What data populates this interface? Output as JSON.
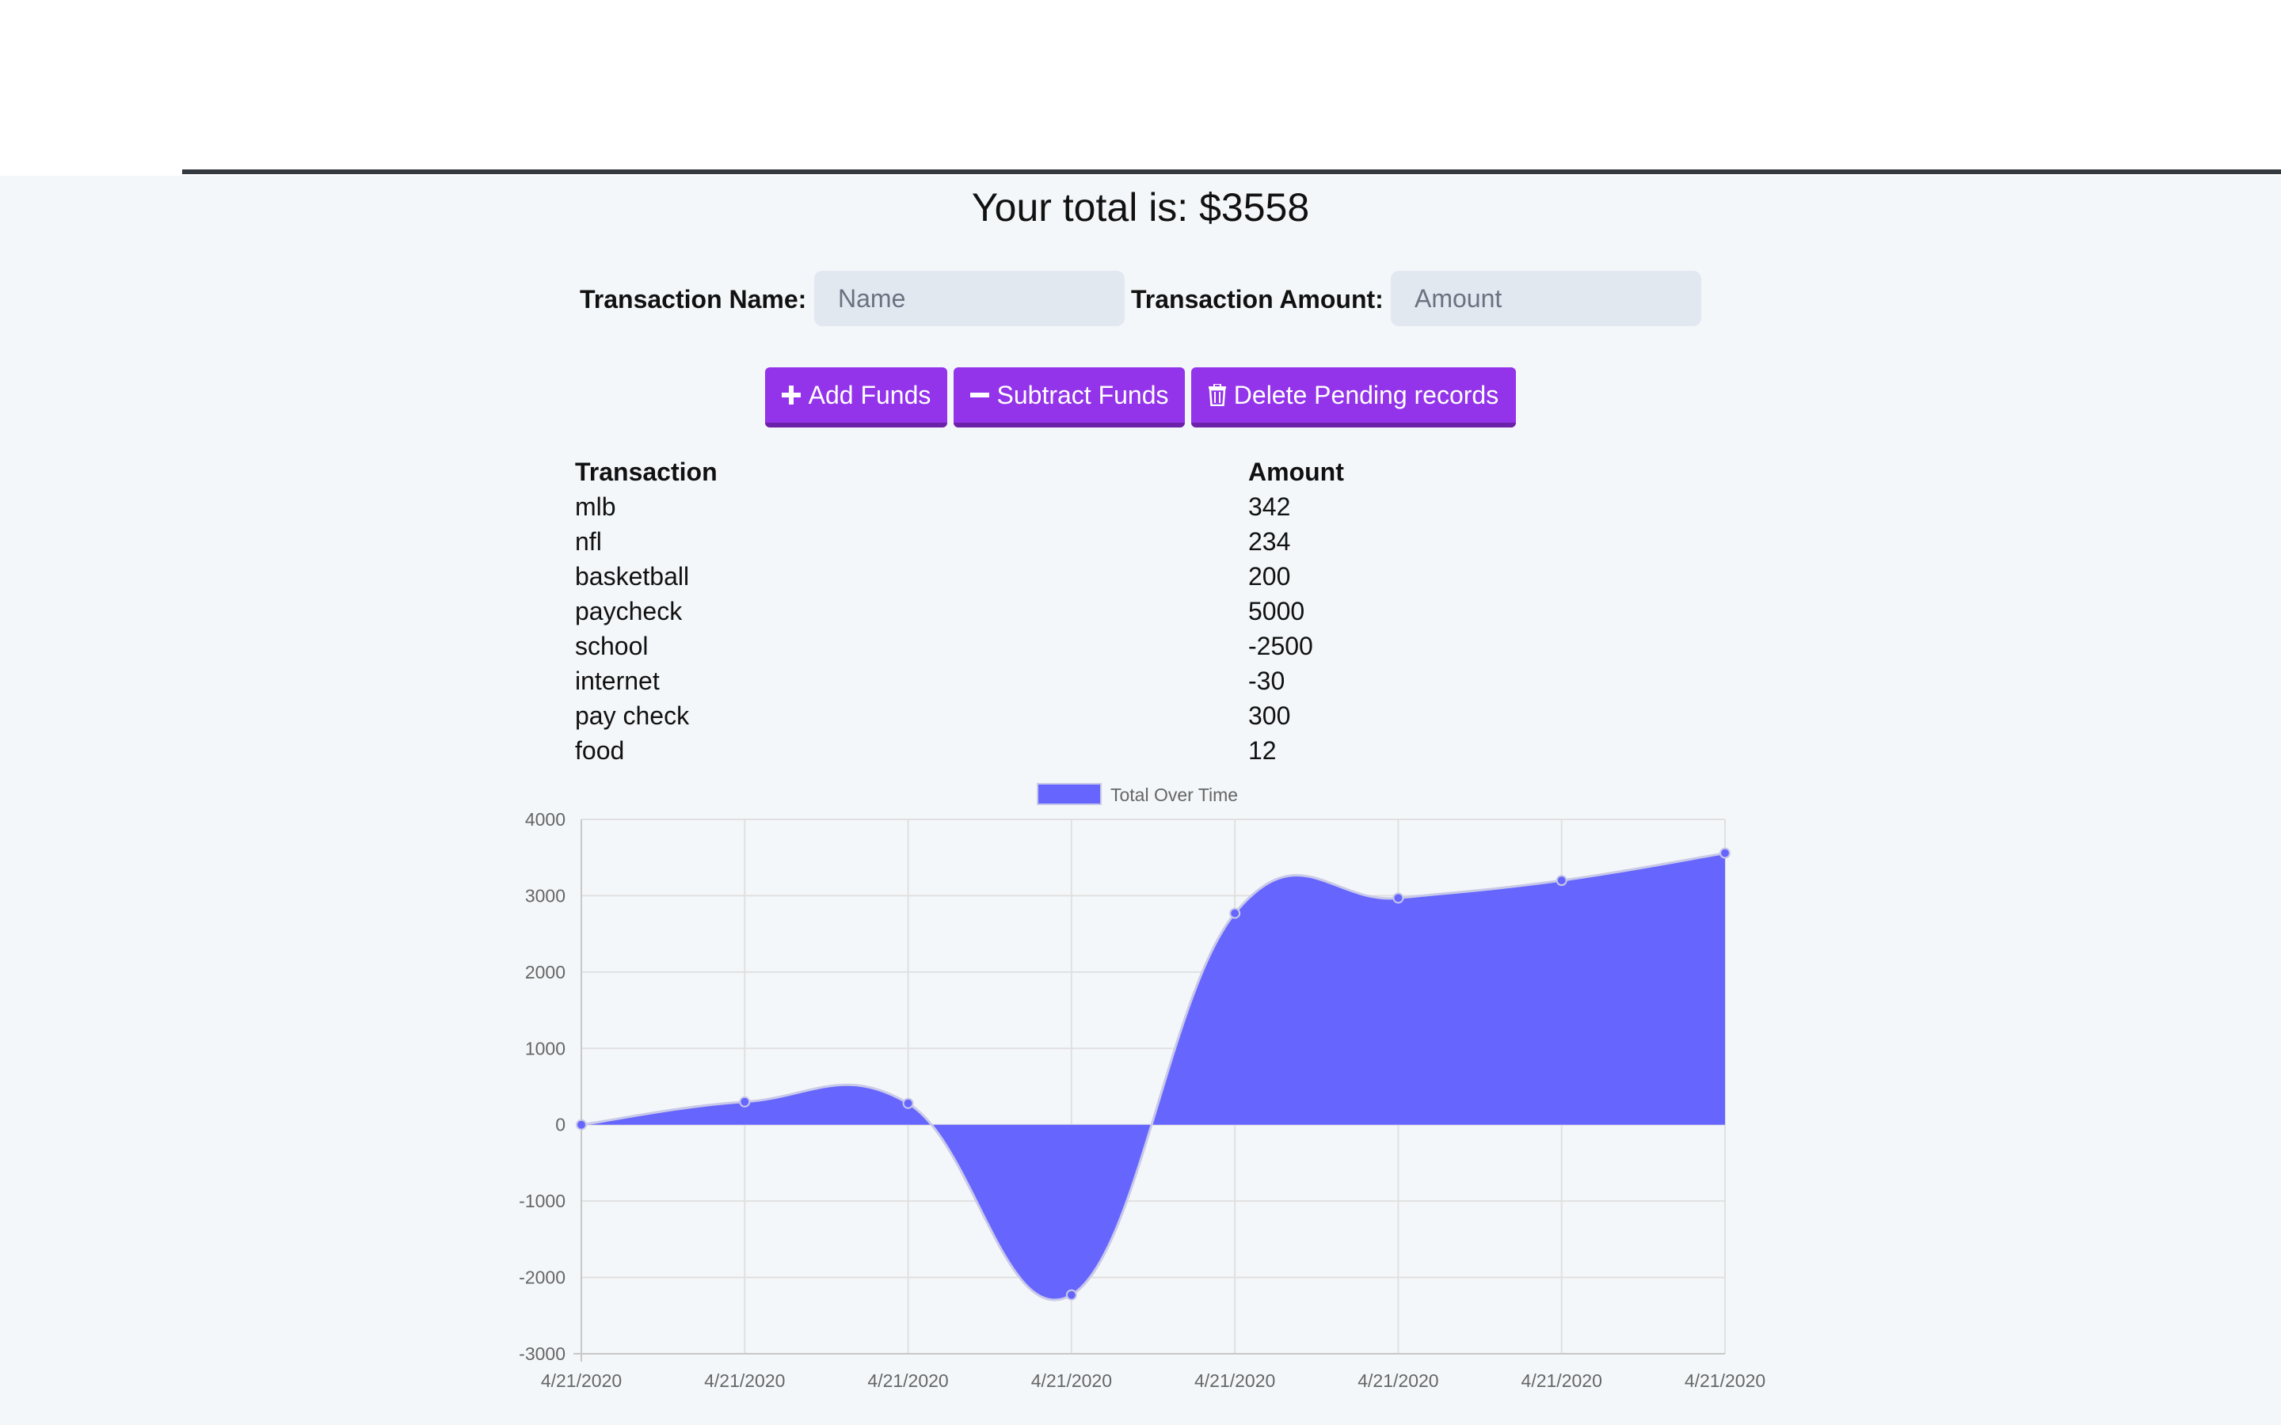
{
  "summary": {
    "total_text": "Your total is: $3558"
  },
  "form": {
    "name_label": "Transaction Name:",
    "name_placeholder": "Name",
    "amount_label": "Transaction Amount:",
    "amount_placeholder": "Amount"
  },
  "buttons": {
    "add_label": "Add Funds",
    "subtract_label": "Subtract Funds",
    "delete_label": "Delete Pending records",
    "add_icon": "plus-icon",
    "subtract_icon": "minus-icon",
    "delete_icon": "trash-icon"
  },
  "table": {
    "headers": [
      "Transaction",
      "Amount"
    ],
    "rows": [
      [
        "mlb",
        "342"
      ],
      [
        "nfl",
        "234"
      ],
      [
        "basketball",
        "200"
      ],
      [
        "paycheck",
        "5000"
      ],
      [
        "school",
        "-2500"
      ],
      [
        "internet",
        "-30"
      ],
      [
        "pay check",
        "300"
      ],
      [
        "food",
        "12"
      ]
    ]
  },
  "colors": {
    "accent": "#9333ea",
    "chart_fill": "#6666ff",
    "chart_line": "#c9c9e8"
  },
  "chart_data": {
    "type": "area",
    "legend": "Total Over Time",
    "legend_position": "top-center",
    "grid": true,
    "x": [
      "4/21/2020",
      "4/21/2020",
      "4/21/2020",
      "4/21/2020",
      "4/21/2020",
      "4/21/2020",
      "4/21/2020",
      "4/21/2020"
    ],
    "series": [
      {
        "name": "Total Over Time",
        "values": [
          0,
          300,
          280,
          -2230,
          2770,
          2970,
          3200,
          3558
        ]
      }
    ],
    "ylim": [
      -3000,
      4000
    ],
    "yticks": [
      4000,
      3000,
      2000,
      1000,
      0,
      -1000,
      -2000,
      -3000
    ]
  }
}
